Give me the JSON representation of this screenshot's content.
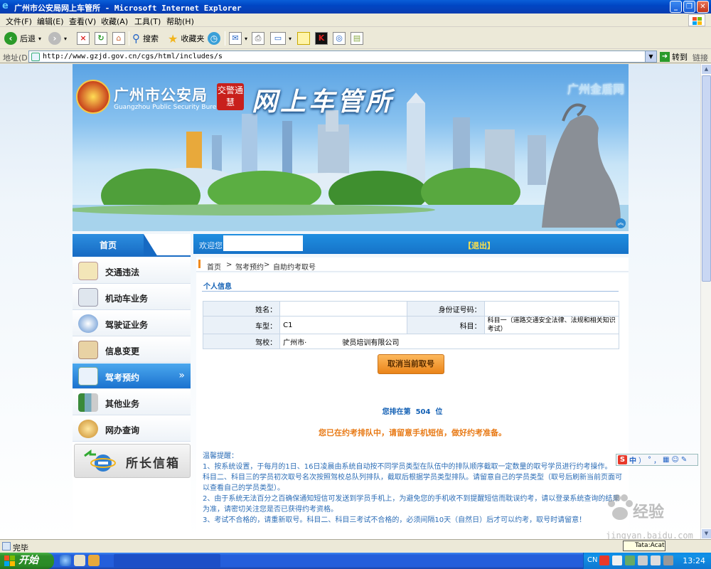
{
  "window": {
    "title": "广州市公安局网上车管所 - Microsoft Internet Explorer",
    "minimize": "_",
    "maximize": "❐",
    "close": "✕"
  },
  "menu": [
    "文件(F)",
    "编辑(E)",
    "查看(V)",
    "收藏(A)",
    "工具(T)",
    "帮助(H)"
  ],
  "toolbar": {
    "back": "后退",
    "search": "搜索",
    "favorites": "收藏夹"
  },
  "address": {
    "label": "地址(D)",
    "url": "http://www.gzjd.gov.cn/cgs/html/includes/s",
    "go": "转到",
    "links": "链接"
  },
  "banner": {
    "org_cn": "广州市公安局",
    "org_en": "Guangzhou Public Security Bureau",
    "seal": "交警通慧",
    "title": "网上车管所",
    "portal": "广州金盾网"
  },
  "nav": {
    "home": "首页",
    "items": [
      {
        "label": "交通违法",
        "icon": "notepad-icon"
      },
      {
        "label": "机动车业务",
        "icon": "vehicle-doc-icon"
      },
      {
        "label": "驾驶证业务",
        "icon": "license-icon"
      },
      {
        "label": "信息变更",
        "icon": "edit-info-icon"
      },
      {
        "label": "驾考预约",
        "icon": "magnifier-icon"
      },
      {
        "label": "其他业务",
        "icon": "binders-icon"
      },
      {
        "label": "网办查询",
        "icon": "search-globe-icon"
      }
    ],
    "active_index": 4,
    "mailbox": "所长信箱"
  },
  "topbar": {
    "welcome": "欢迎您，",
    "logout": "【退出】"
  },
  "breadcrumb": [
    "首页",
    ">",
    "驾考预约",
    ">",
    "自助约考取号"
  ],
  "section_title": "个人信息",
  "info": {
    "name_label": "姓名：",
    "name_value": "",
    "id_label": "身份证号码：",
    "id_value": "",
    "type_label": "车型：",
    "type_value": "C1",
    "subject_label": "科目：",
    "subject_value": "科目一（道路交通安全法律、法规和相关知识考试）",
    "school_label": "驾校：",
    "school_value": "广州市·　　　　　驶员培训有限公司"
  },
  "cancel_button": "取消当前取号",
  "queue": {
    "prefix": "您排在第",
    "position": "504",
    "suffix": "位"
  },
  "queue_notice": "您已在约考排队中，请留意手机短信，做好约考准备。",
  "tips": [
    "温馨提醒：",
    "1、按系统设置，于每月的1日、16日凌晨由系统自动按不同学员类型在队伍中的排队顺序截取一定数量的取号学员进行约考操作。",
    "科目二、科目三的学员初次取号名次按照驾校总队列排队，截取后根据学员类型排队。请留意自己的学员类型（取号后刷新当前页面可以查看自己的学员类型）。",
    "2、由于系统无法百分之百确保通知短信可发送到学员手机上，为避免您的手机收不到提醒短信而耽误约考，请以登录系统查询的结果为准，请密切关注您是否已获得约考资格。",
    "3、考试不合格的，请重新取号。科目二、科目三考试不合格的，必须间隔10天（自然日）后才可以约考，取号时请留意！"
  ],
  "ime": [
    "中",
    "）",
    "°",
    "，"
  ],
  "watermark": {
    "name": "经验",
    "site": "jingyan.baidu.com"
  },
  "status": {
    "text": "完毕"
  },
  "taskbar": {
    "start": "开始",
    "lang": "CN",
    "clock": "13:24",
    "popup": "Tata:Acat"
  }
}
